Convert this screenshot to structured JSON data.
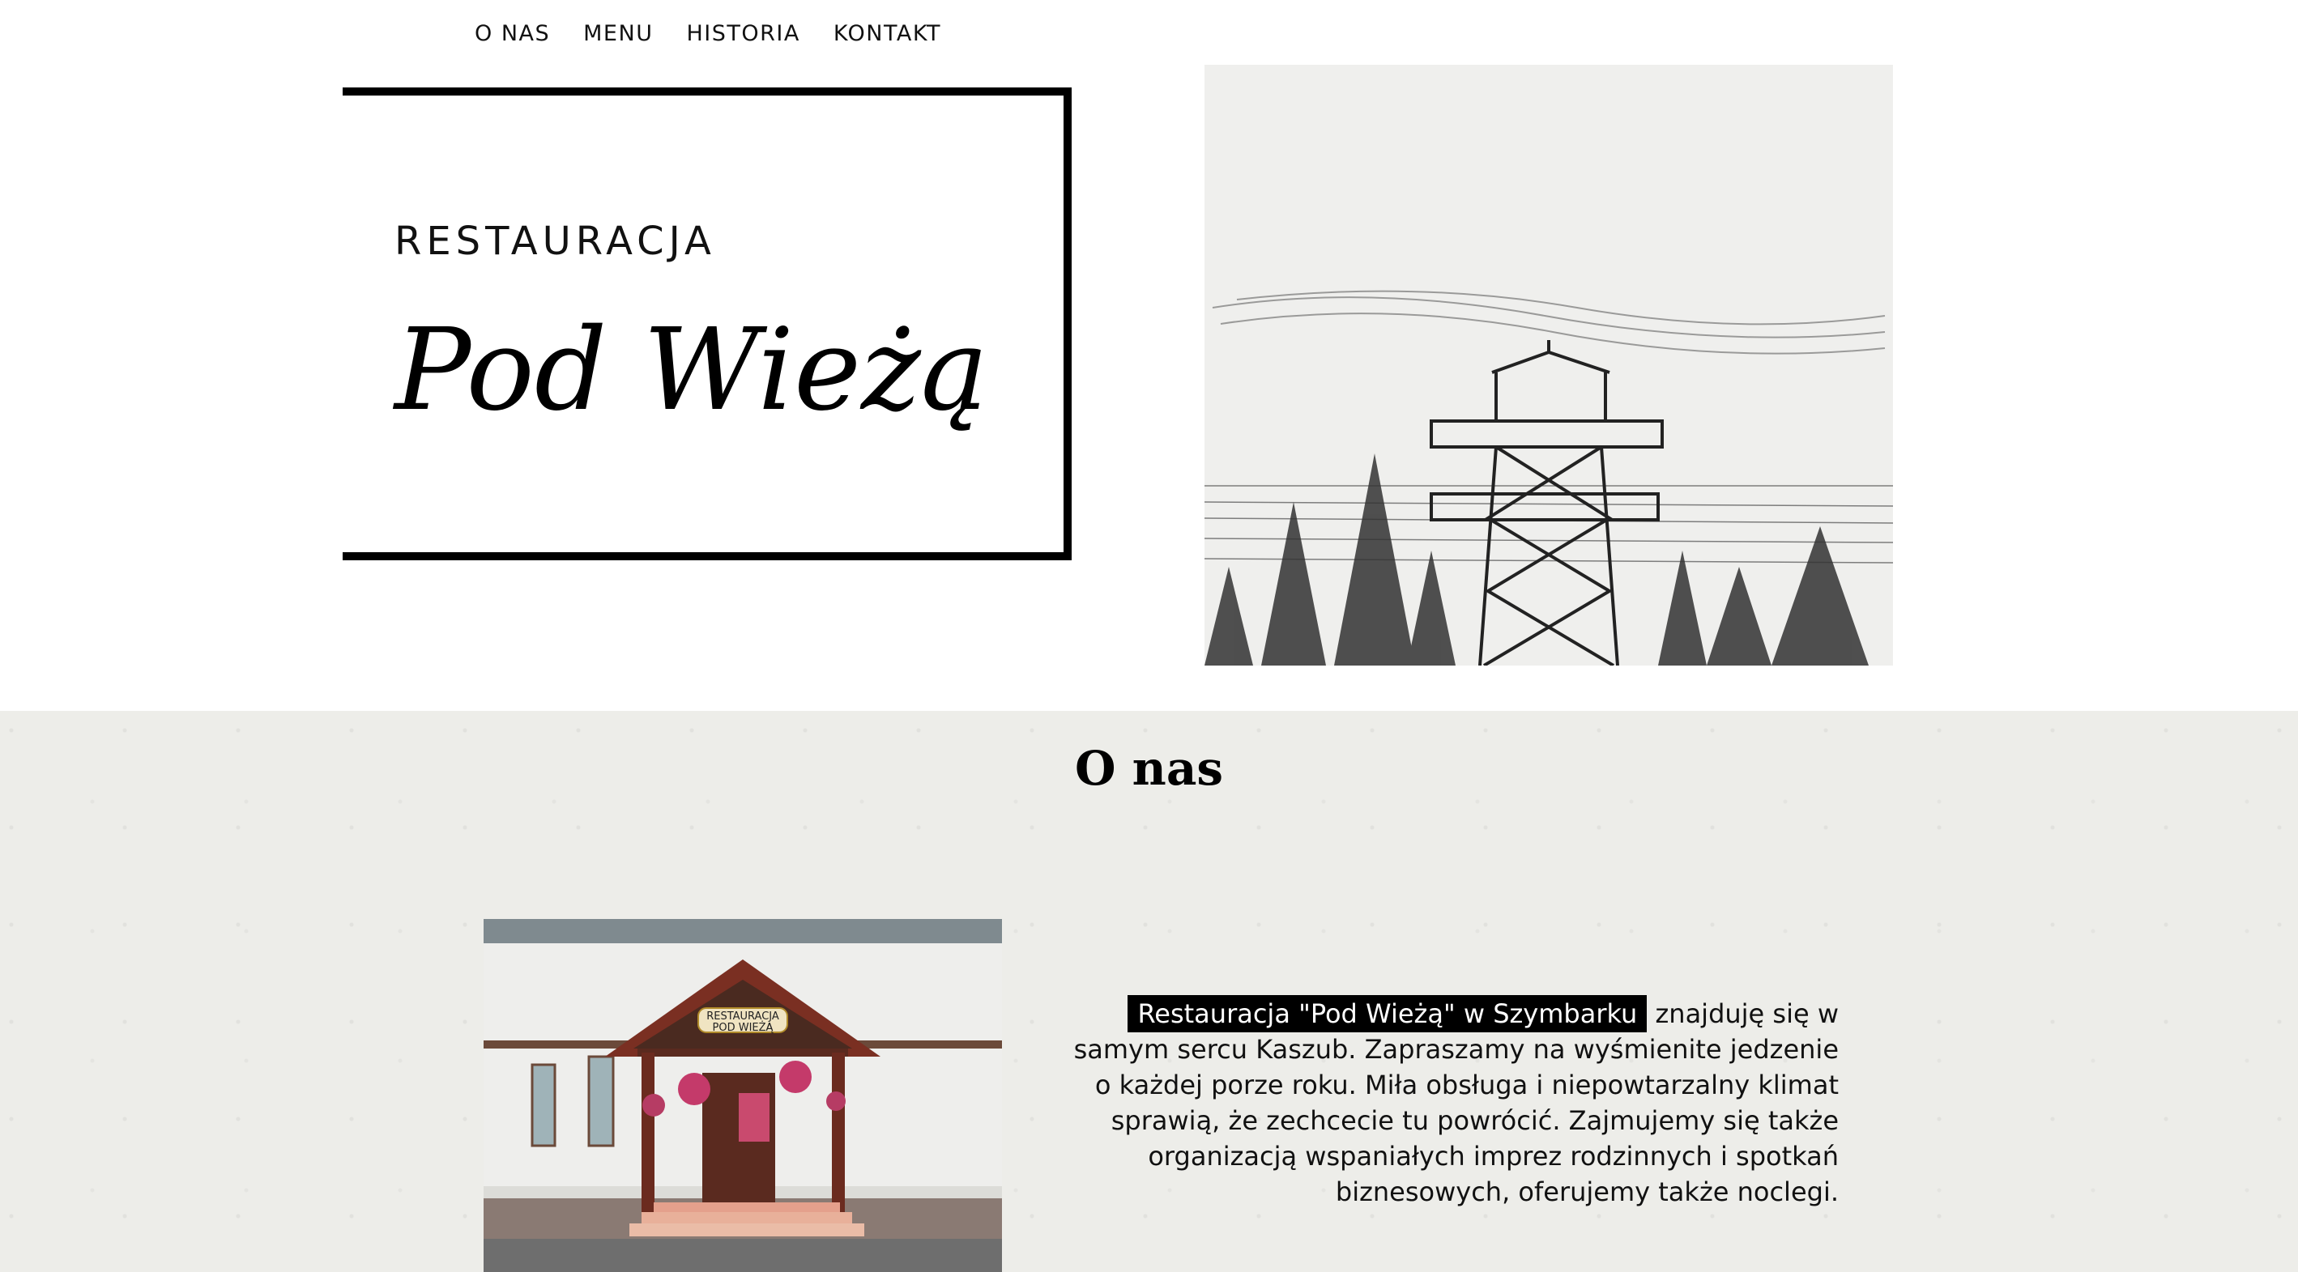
{
  "nav": {
    "items": [
      "O NAS",
      "MENU",
      "HISTORIA",
      "KONTAKT"
    ]
  },
  "logo": {
    "subtitle": "RESTAURACJA",
    "name": "Pod Wieżą"
  },
  "about": {
    "title": "O nas",
    "highlight": "Restauracja \"Pod Wieżą\" w Szymbarku",
    "text": " znajduję się w samym sercu Kaszub. Zapraszamy na wyśmienite jedzenie o każdej porze roku. Miła obsługa i niepowtarzalny klimat sprawią, że zechcecie tu powrócić. Zajmujemy się także organizacją wspaniałych imprez rodzinnych i spotkań biznesowych, oferujemy także noclegi."
  },
  "photo_sign": {
    "line1": "RESTAURACJA",
    "line2": "POD WIEŻĄ"
  },
  "colors": {
    "section_bg": "#edede9",
    "highlight_bg": "#000000",
    "highlight_text": "#ffffff"
  }
}
